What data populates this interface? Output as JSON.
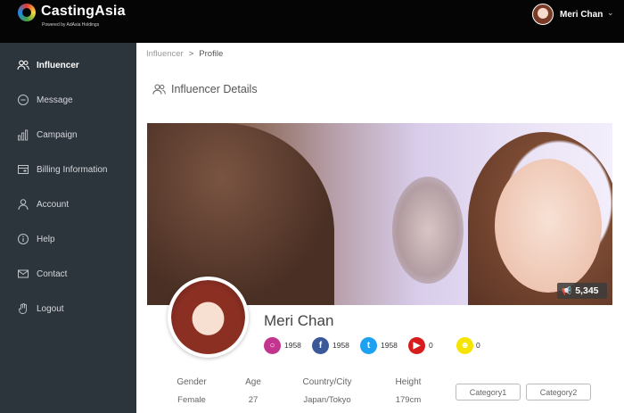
{
  "header": {
    "brand": "CastingAsia",
    "tagline": "Powered by AdAsia Holdings",
    "user_name": "Meri Chan"
  },
  "sidebar": {
    "items": [
      {
        "label": "Influencer",
        "icon": "people-icon",
        "active": true
      },
      {
        "label": "Message",
        "icon": "chat-icon",
        "active": false
      },
      {
        "label": "Campaign",
        "icon": "bar-chart-icon",
        "active": false
      },
      {
        "label": "Billing Information",
        "icon": "billing-icon",
        "active": false
      },
      {
        "label": "Account",
        "icon": "user-icon",
        "active": false
      },
      {
        "label": "Help",
        "icon": "info-icon",
        "active": false
      },
      {
        "label": "Contact",
        "icon": "mail-icon",
        "active": false
      },
      {
        "label": "Logout",
        "icon": "hand-icon",
        "active": false
      }
    ]
  },
  "breadcrumb": {
    "parent": "Influencer",
    "separator": ">",
    "current": "Profile"
  },
  "section_title": "Influencer Details",
  "profile": {
    "likes": "5,345",
    "name": "Meri Chan",
    "social": [
      {
        "network": "instagram",
        "icon": "instagram-icon",
        "count": "1958",
        "color": "#c1358f"
      },
      {
        "network": "facebook",
        "icon": "facebook-icon",
        "count": "1958",
        "color": "#3b5998"
      },
      {
        "network": "twitter",
        "icon": "twitter-icon",
        "count": "1958",
        "color": "#1da1f2"
      },
      {
        "network": "youtube",
        "icon": "youtube-icon",
        "count": "0",
        "color": "#d81b1b"
      },
      {
        "network": "snapchat",
        "icon": "snapchat-icon",
        "count": "0",
        "color": "#fffc00"
      }
    ],
    "details": {
      "gender_label": "Gender",
      "gender_value": "Female",
      "age_label": "Age",
      "age_value": "27",
      "location_label": "Country/City",
      "location_value": "Japan/Tokyo",
      "height_label": "Height",
      "height_value": "179cm"
    },
    "categories": [
      "Category1",
      "Category2"
    ]
  }
}
